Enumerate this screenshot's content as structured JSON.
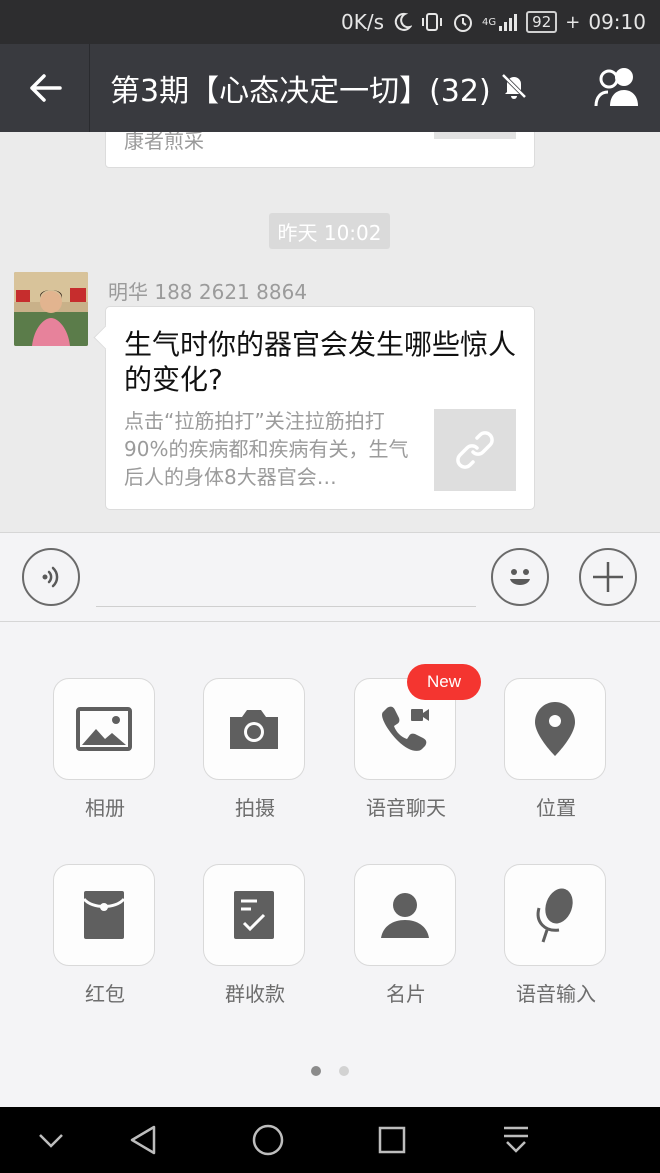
{
  "status_bar": {
    "net_speed": "0K/s",
    "network": "4G",
    "battery": "92",
    "time": "09:10"
  },
  "header": {
    "title": "第3期【心态决定一切】(32)"
  },
  "chat": {
    "prev_card_text": "康者煎采",
    "timestamp": "昨天 10:02",
    "sender_name": "明华 188 2621 8864",
    "message": {
      "title": "生气时你的器官会发生哪些惊人的变化?",
      "description": "点击“拉筋拍打”关注拉筋拍打90%的疾病都和疾病有关，生气后人的身体8大器官会…"
    }
  },
  "panel": {
    "tiles": [
      {
        "label": "相册",
        "icon": "photo-album-icon"
      },
      {
        "label": "拍摄",
        "icon": "camera-icon"
      },
      {
        "label": "语音聊天",
        "icon": "voice-call-icon"
      },
      {
        "label": "位置",
        "icon": "location-pin-icon"
      },
      {
        "label": "红包",
        "icon": "red-packet-icon"
      },
      {
        "label": "群收款",
        "icon": "group-payment-icon"
      },
      {
        "label": "名片",
        "icon": "contact-card-icon"
      },
      {
        "label": "语音输入",
        "icon": "microphone-icon"
      }
    ],
    "new_badge": "New",
    "page_count": 2,
    "current_page": 1
  },
  "colors": {
    "header_bg": "#393a3f",
    "badge_red": "#f43530"
  }
}
